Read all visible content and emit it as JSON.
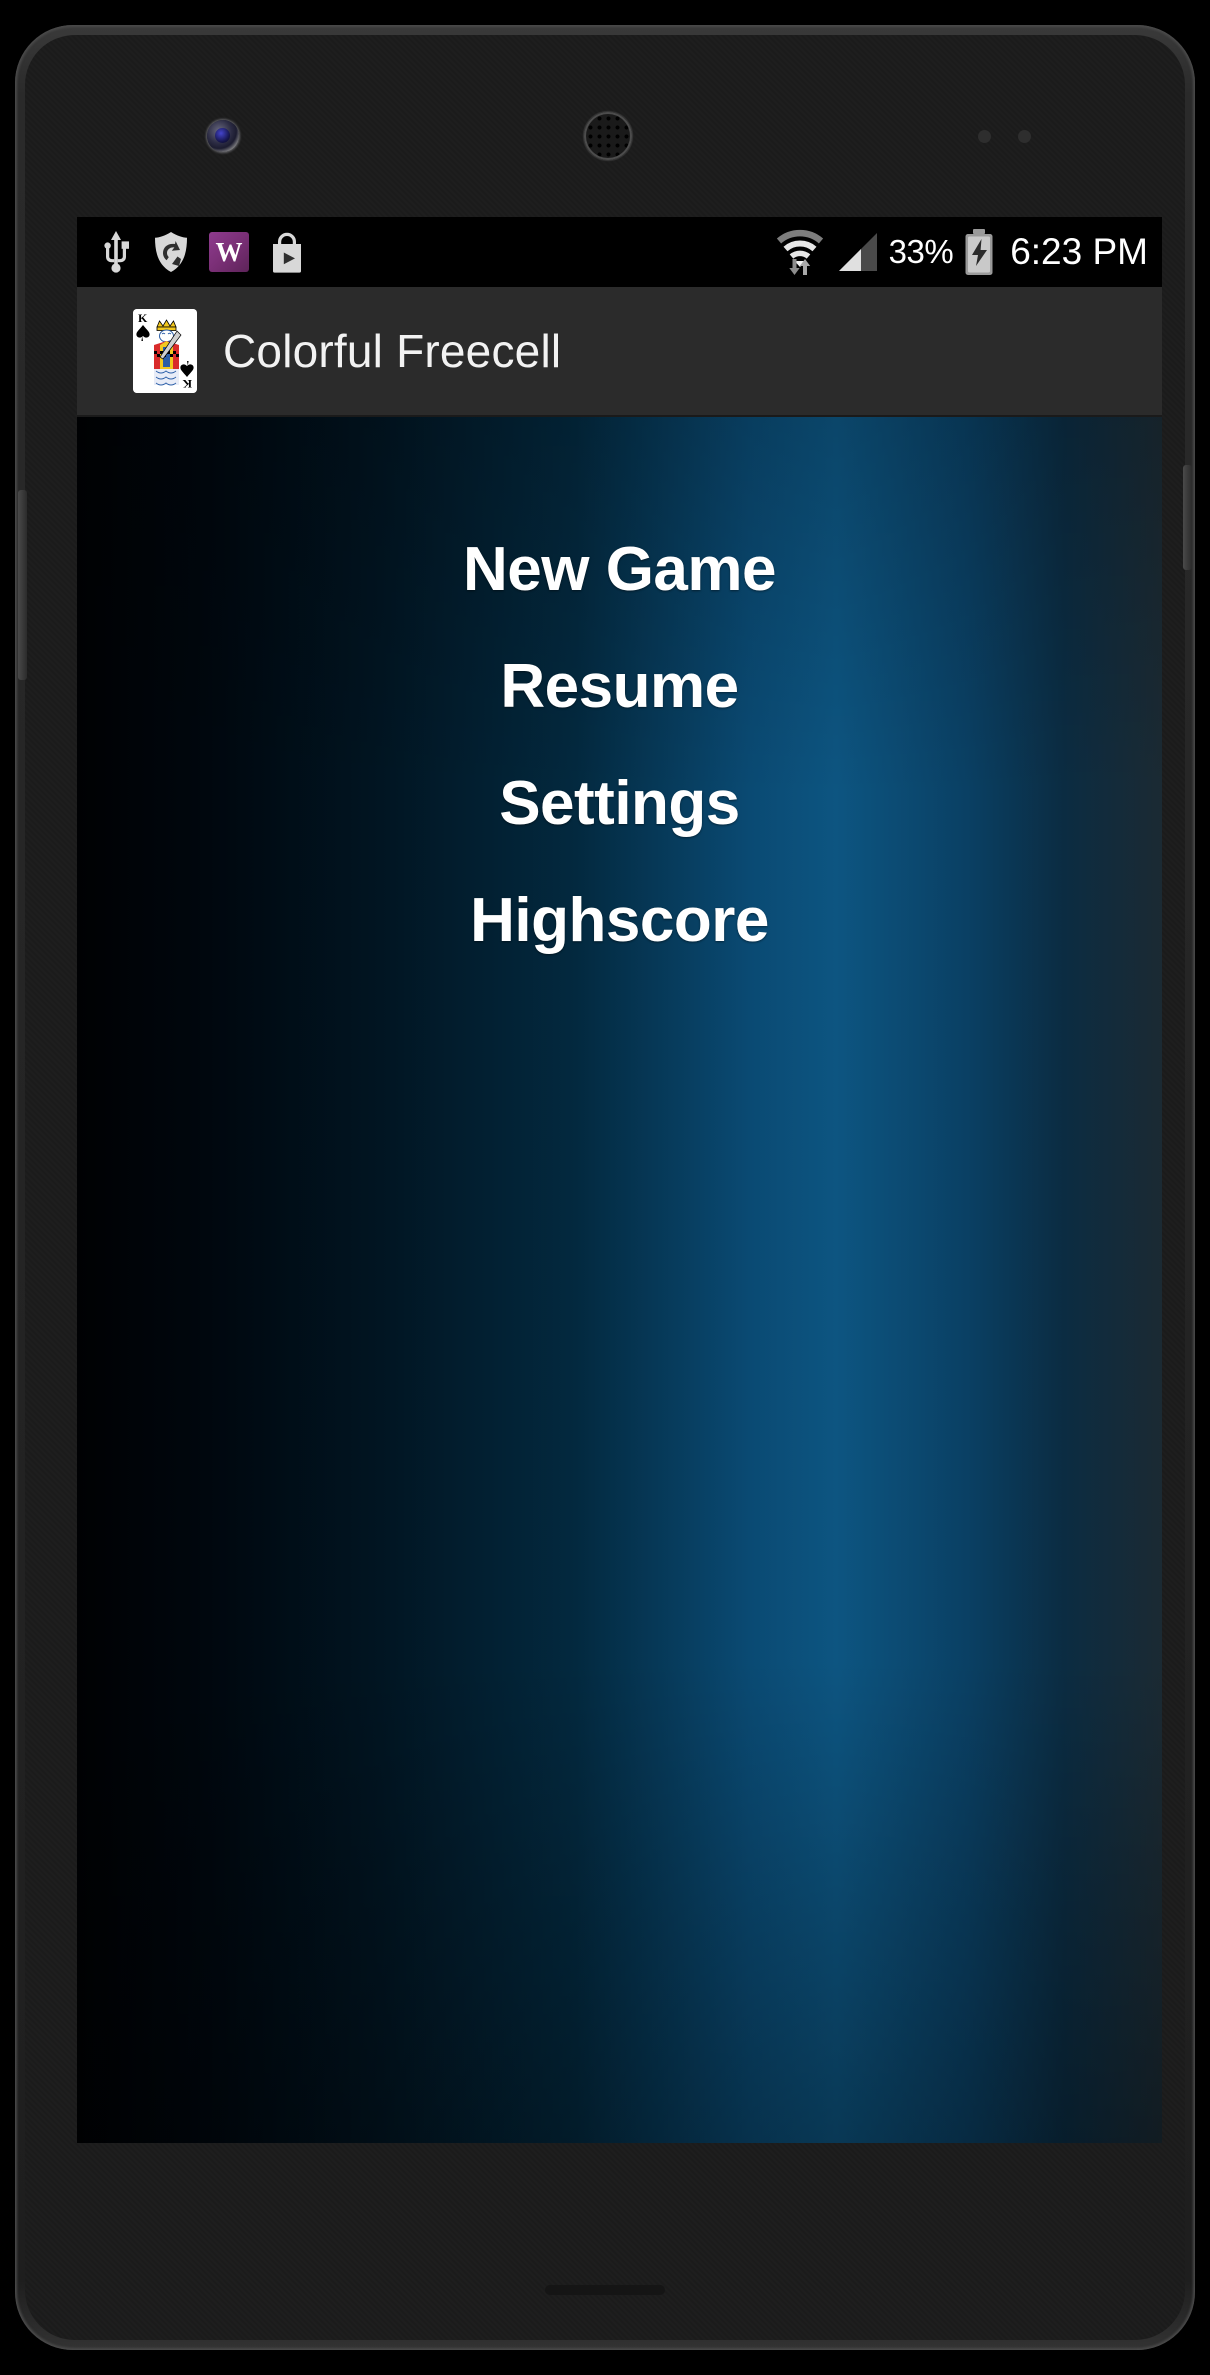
{
  "device": {
    "type": "android-phone",
    "front_camera": "front-camera",
    "earpiece": "earpiece-speaker"
  },
  "status_bar": {
    "background_color": "#000000",
    "left_icons": [
      {
        "name": "usb-icon",
        "label": "USB connected"
      },
      {
        "name": "shield-icon",
        "label": "Security shield sync"
      },
      {
        "name": "wordpress-icon",
        "label": "W"
      },
      {
        "name": "play-store-icon",
        "label": "Play Store"
      }
    ],
    "right_icons": [
      {
        "name": "wifi-icon",
        "label": "Wi-Fi with data transfer"
      },
      {
        "name": "cellular-signal-icon",
        "label": "Cellular signal"
      },
      {
        "name": "battery-charging-icon",
        "label": "Battery charging"
      }
    ],
    "battery_percent": "33%",
    "time": "6:23 PM"
  },
  "action_bar": {
    "background_color": "#2b2b2b",
    "app_icon": "king-of-spades-card-icon",
    "title": "Colorful Freecell"
  },
  "game": {
    "background_gradient_from": "#000103",
    "background_gradient_to": "#0d5581",
    "accent_color": "#0a4a73",
    "menu_text_color": "#ffffff",
    "menu": [
      {
        "label": "New Game"
      },
      {
        "label": "Resume"
      },
      {
        "label": "Settings"
      },
      {
        "label": "Highscore"
      }
    ]
  }
}
